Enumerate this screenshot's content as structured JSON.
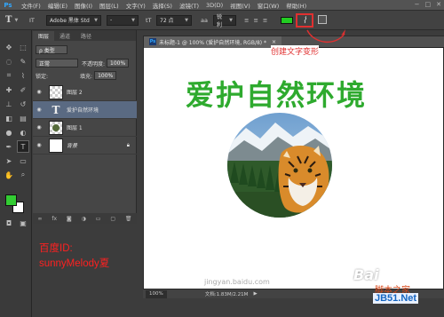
{
  "app": {
    "logo": "Ps"
  },
  "menu": [
    "文件(F)",
    "编辑(E)",
    "图像(I)",
    "图层(L)",
    "文字(Y)",
    "选择(S)",
    "滤镜(T)",
    "3D(D)",
    "视图(V)",
    "窗口(W)",
    "帮助(H)"
  ],
  "window_controls": [
    "−",
    "□",
    "✕"
  ],
  "options": {
    "tool_icon": "T",
    "orient_icon": "IT",
    "font_family": "Adobe 黑体 Std",
    "font_style": "-",
    "size_icon": "tT",
    "font_size": "72 点",
    "aa_icon": "aa",
    "antialias": "锐利",
    "text_color": "#22cc22",
    "warp_icon": "warp-text-icon",
    "panel_icon": "character-panel-icon"
  },
  "annotation": {
    "text": "创建文字变形",
    "color": "#e03030"
  },
  "tools": {
    "fg_color": "#33cc33",
    "bg_color": "#ffffff"
  },
  "layers_panel": {
    "tabs": [
      "图层",
      "通道",
      "路径"
    ],
    "filter_kind": "ρ 类型",
    "blend_mode": "正常",
    "opacity_label": "不透明度:",
    "opacity_value": "100%",
    "lock_label": "锁定:",
    "fill_label": "填充:",
    "fill_value": "100%",
    "layers": [
      {
        "name": "图层 2",
        "type": "checker",
        "selected": false
      },
      {
        "name": "爱护自然环境",
        "type": "text",
        "selected": true
      },
      {
        "name": "图层 1",
        "type": "checker",
        "selected": false
      },
      {
        "name": "背景",
        "type": "white",
        "selected": false
      }
    ]
  },
  "credit": {
    "line1": "百度ID:",
    "line2": "sunnyMelody夏",
    "color": "#ff2020"
  },
  "document": {
    "tab_title": "未标题-1 @ 100% (爱护自然环境, RGB/8) *",
    "canvas_text": "爱护自然环境",
    "canvas_text_color": "#2eaa2e",
    "zoom": "100%",
    "doc_size": "文档:1.83M/2.21M"
  },
  "watermarks": {
    "site": "jingyan.baidu.com",
    "baidu": "Bai",
    "jb51_sub": "脚本之家",
    "jb51": "JB51.Net"
  }
}
